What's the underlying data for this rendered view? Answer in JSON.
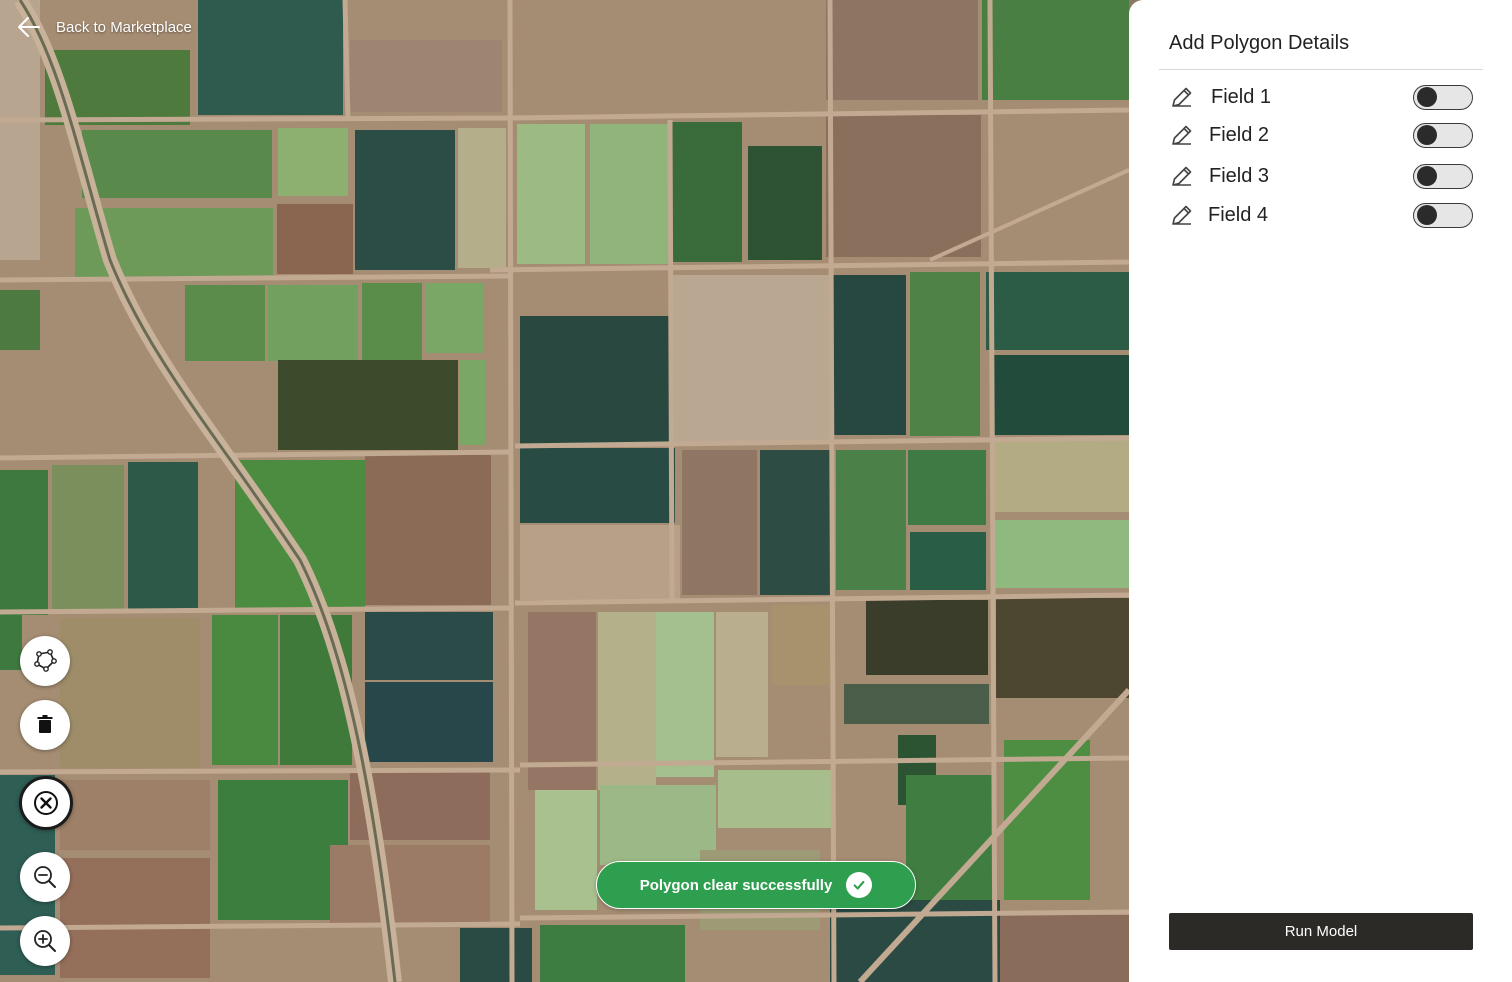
{
  "nav": {
    "back_label": "Back to Marketplace"
  },
  "map_controls": [
    {
      "name": "draw-polygon-button",
      "icon": "polygon-icon",
      "active": false
    },
    {
      "name": "delete-polygon-button",
      "icon": "trash-icon",
      "active": false
    },
    {
      "name": "clear-button",
      "icon": "close-icon",
      "active": true
    },
    {
      "name": "zoom-out-button",
      "icon": "zoom-out-icon",
      "active": false
    },
    {
      "name": "zoom-in-button",
      "icon": "zoom-in-icon",
      "active": false
    }
  ],
  "toast": {
    "message": "Polygon clear successfully",
    "icon": "check-icon",
    "color": "#2e9e4f"
  },
  "panel": {
    "title": "Add Polygon Details",
    "fields": [
      {
        "label": "Field 1",
        "enabled": false
      },
      {
        "label": "Field 2",
        "enabled": false
      },
      {
        "label": "Field 3",
        "enabled": false
      },
      {
        "label": "Field 4",
        "enabled": false
      }
    ],
    "run_label": "Run Model"
  }
}
